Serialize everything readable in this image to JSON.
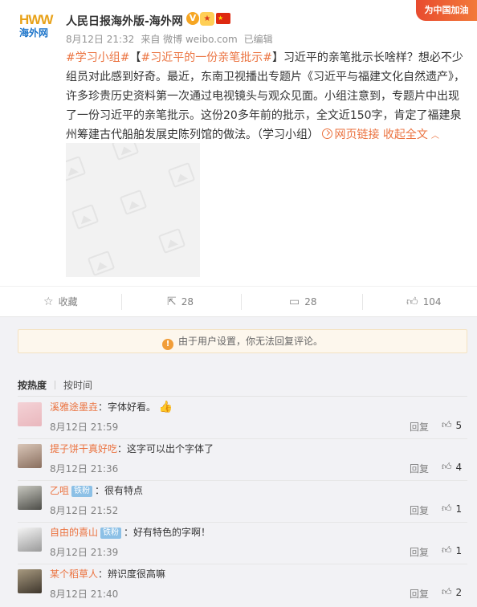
{
  "post": {
    "logo_hw_1": "HW",
    "logo_hw_2": "W",
    "logo_cn": "海外网",
    "author": "人民日报海外版-海外网",
    "verified_mark": "V",
    "corner_banner": "为中国加油",
    "meta": {
      "time": "8月12日 21:32",
      "source": "来自 微博 weibo.com",
      "edited": "已编辑"
    },
    "text": {
      "tag1": "#学习小组#",
      "bracket_open": "【",
      "tag2": "#习近平的一份亲笔批示#",
      "bracket_close": "】",
      "body": "习近平的亲笔批示长啥样？想必不少组员对此感到好奇。最近，东南卫视播出专题片《习近平与福建文化自然遗产》，许多珍贵历史资料第一次通过电视镜头与观众见面。小组注意到，专题片中出现了一份习近平的亲笔批示。这份20多年前的批示，全文近150字，肯定了福建泉州筹建古代船舶发展史陈列馆的做法。（学习小组）",
      "web_link": "网页链接",
      "collapse": "收起全文"
    }
  },
  "actions": {
    "favorite": {
      "label": "收藏",
      "icon": "star-icon"
    },
    "repost": {
      "count": "28",
      "icon": "repost-icon"
    },
    "comment": {
      "count": "28",
      "icon": "comment-icon"
    },
    "like": {
      "count": "104",
      "icon": "thumbs-up-icon"
    }
  },
  "comments_section": {
    "notice": "由于用户设置，你无法回复评论。",
    "sort_hot": "按热度",
    "sort_time": "按时间",
    "items": [
      {
        "user": "溪雅途墨垚",
        "text": "：字体好看。",
        "badge": "",
        "emoji": "👍",
        "time": "8月12日 21:59",
        "reply": "回复",
        "likes": "5"
      },
      {
        "user": "提子饼干真好吃",
        "text": "：这字可以出个字体了",
        "badge": "",
        "emoji": "",
        "time": "8月12日 21:36",
        "reply": "回复",
        "likes": "4"
      },
      {
        "user": "乙咀",
        "text": "：很有特点",
        "badge": "铁粉",
        "emoji": "",
        "time": "8月12日 21:52",
        "reply": "回复",
        "likes": "1"
      },
      {
        "user": "自由的喜山",
        "text": "：好有特色的字啊！",
        "badge": "铁粉",
        "emoji": "",
        "time": "8月12日 21:39",
        "reply": "回复",
        "likes": "1"
      },
      {
        "user": "某个稻草人",
        "text": "：辨识度很高嘛",
        "badge": "",
        "emoji": "",
        "time": "8月12日 21:40",
        "reply": "回复",
        "likes": "2"
      }
    ]
  },
  "colors": {
    "accent": "#eb7340",
    "background": "#f2f2f5",
    "notice_bg": "#fdf7ed"
  }
}
